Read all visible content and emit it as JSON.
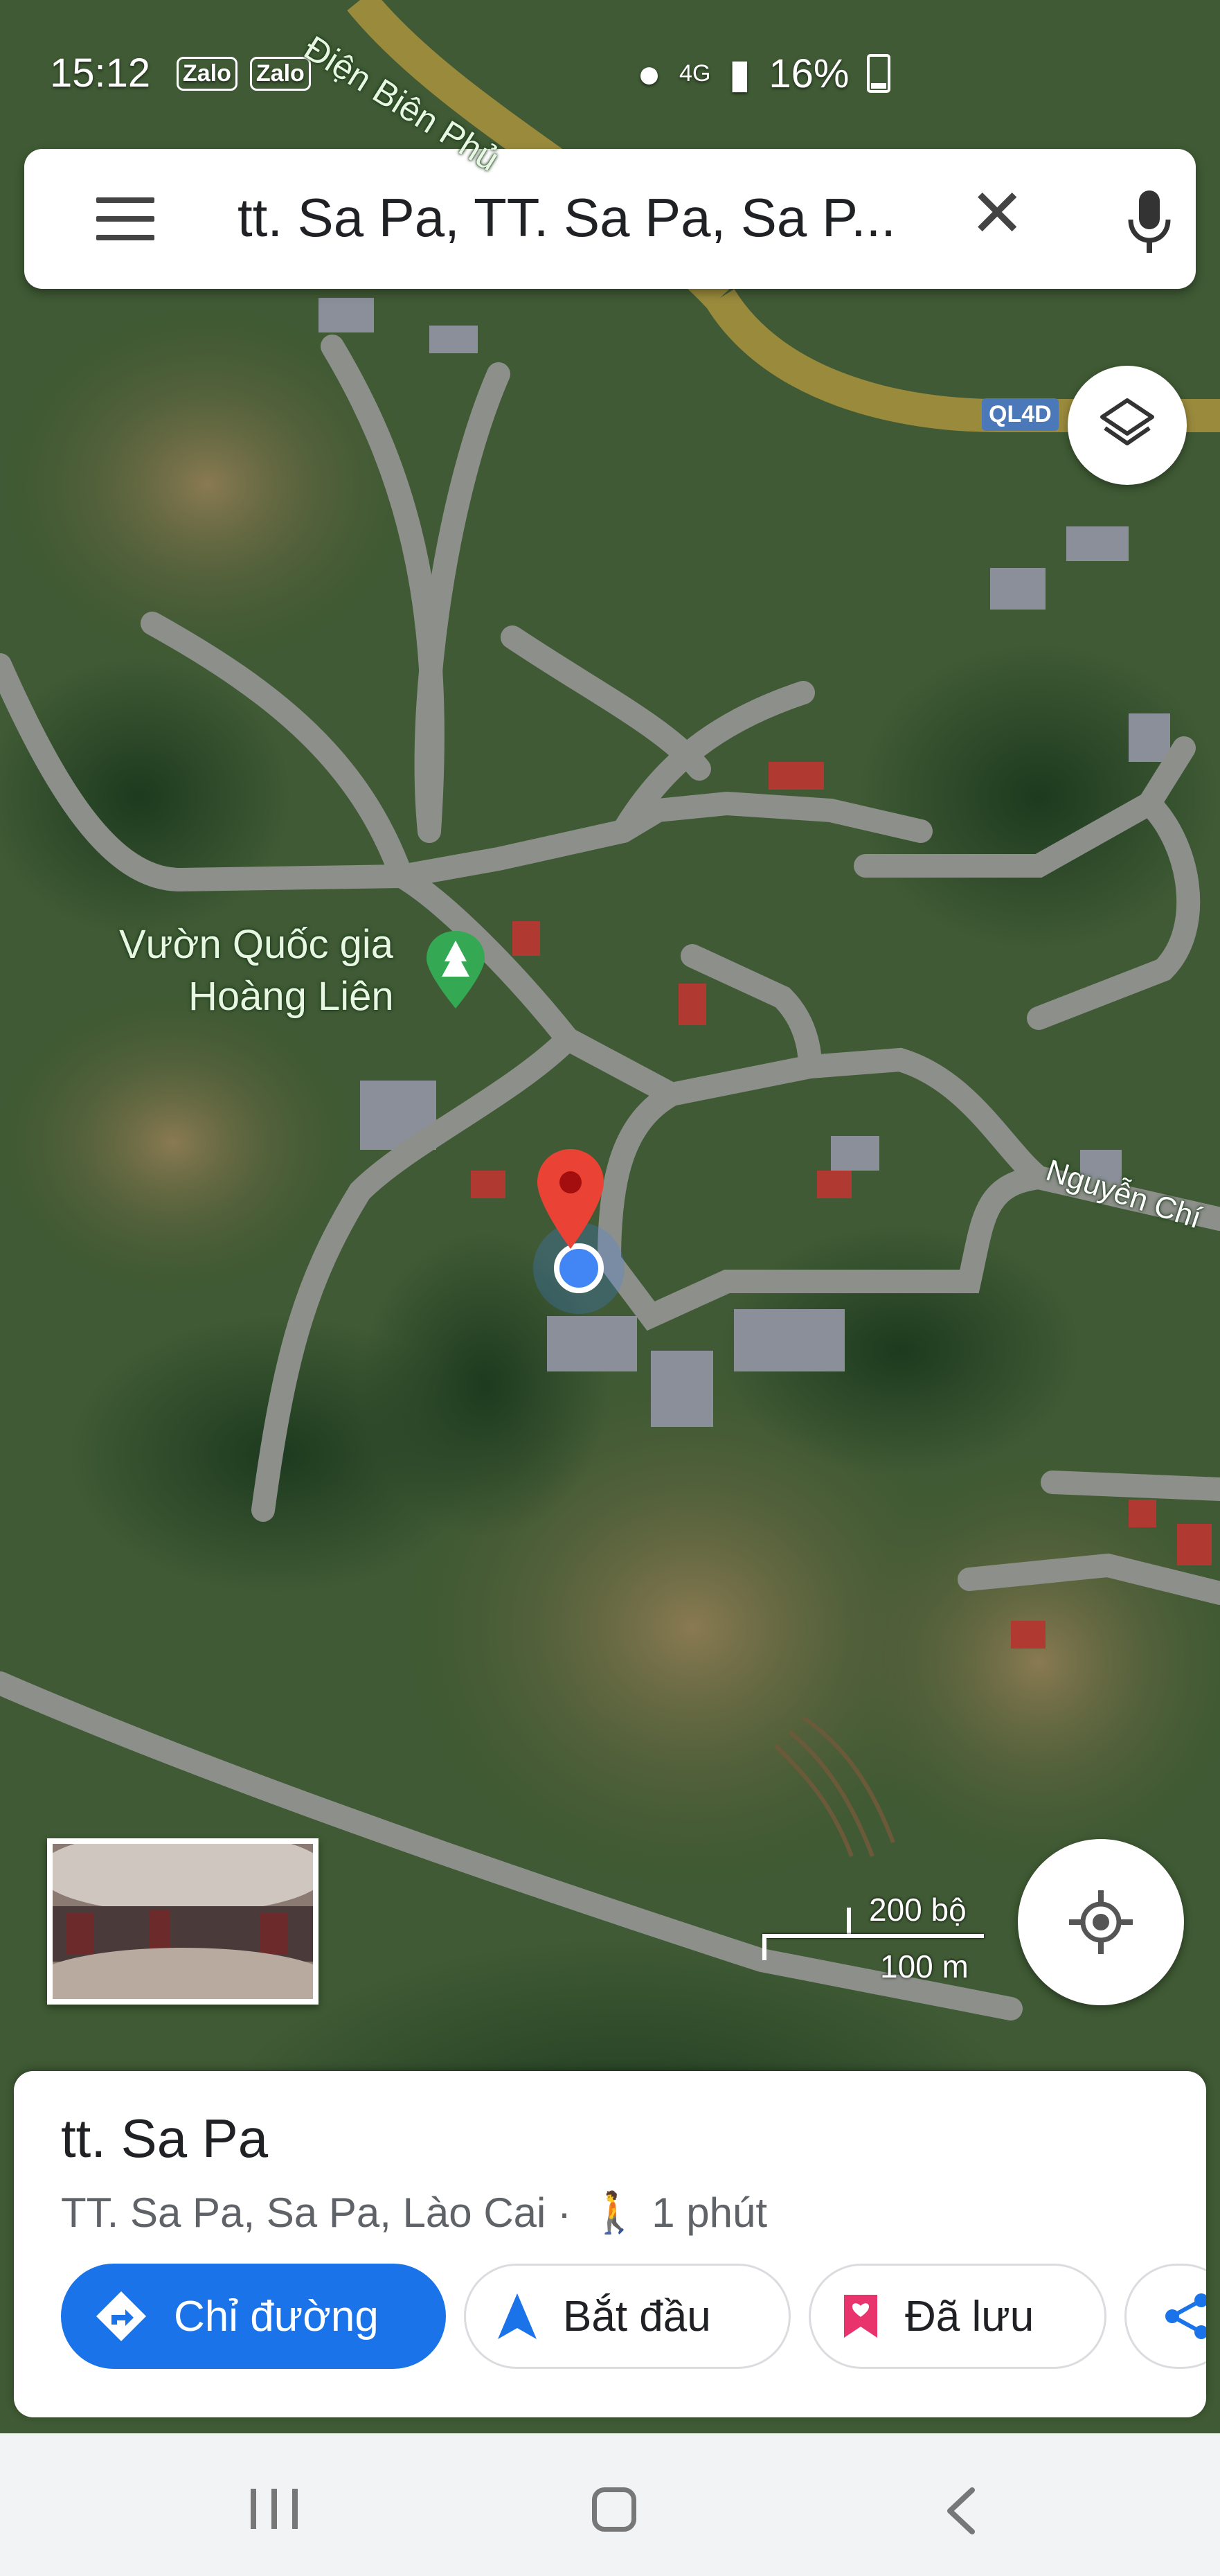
{
  "status_bar": {
    "time": "15:12",
    "app_icons": [
      "Zalo",
      "Zalo"
    ],
    "network": "4G",
    "battery": "16%"
  },
  "search": {
    "query": "tt. Sa Pa, TT. Sa Pa, Sa P..."
  },
  "map": {
    "type": "satellite",
    "labels": {
      "street_top": "Điện Biên Phủ",
      "road_badge": "QL4D",
      "park_line1": "Vườn Quốc gia",
      "park_line2": "Hoàng Liên",
      "street_right": "Nguyễn Chí"
    },
    "scale": {
      "top": "200 bộ",
      "bottom": "100 m"
    }
  },
  "place": {
    "title": "tt. Sa Pa",
    "subtitle": "TT. Sa Pa, Sa Pa, Lào Cai ·",
    "walk_time": "1 phút"
  },
  "actions": {
    "directions": "Chỉ đường",
    "start": "Bắt đầu",
    "saved": "Đã lưu"
  },
  "colors": {
    "primary_blue": "#1a73e8",
    "pin_red": "#ea4335",
    "location_blue": "#4285f4",
    "saved_pink": "#e8336d"
  }
}
